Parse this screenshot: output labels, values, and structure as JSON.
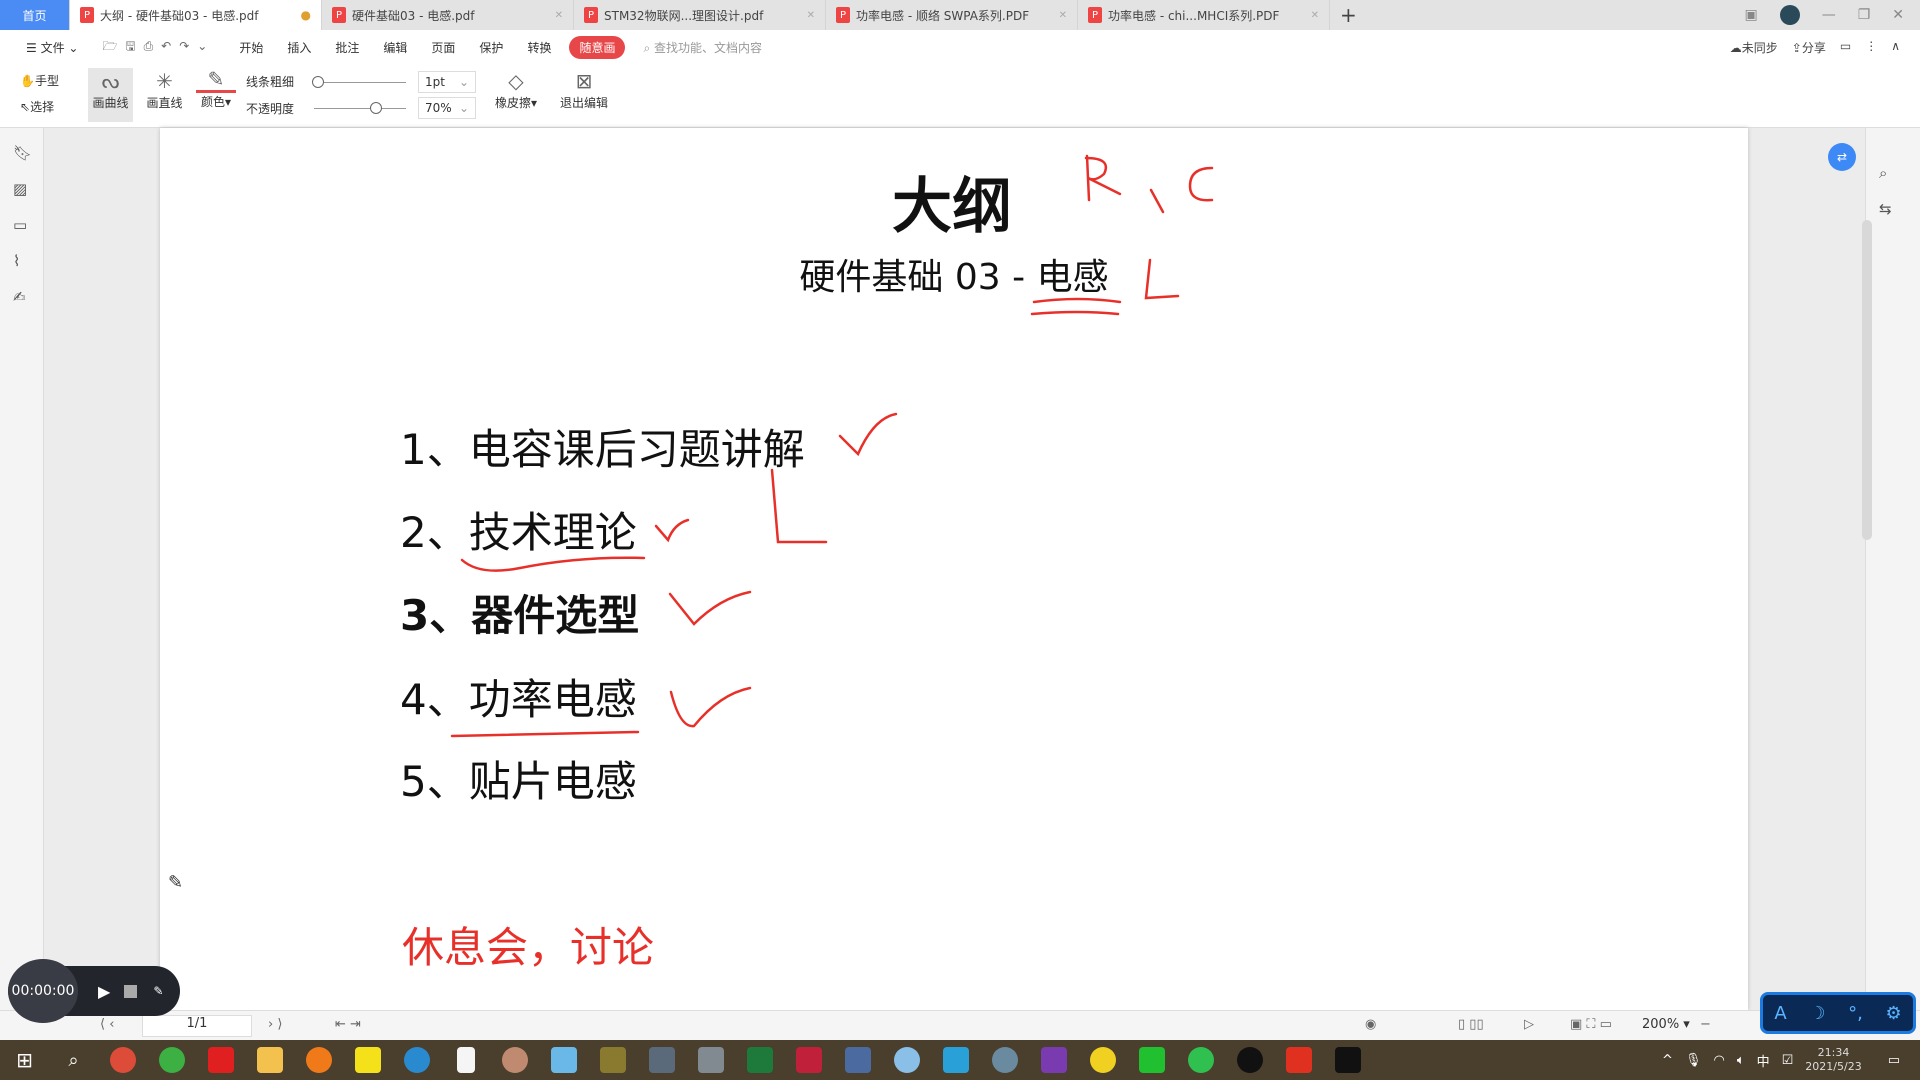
{
  "tabs": [
    {
      "label": "首页",
      "type": "home"
    },
    {
      "label": "大纲 - 硬件基础03 - 电感.pdf",
      "active": true,
      "modified": true
    },
    {
      "label": "硬件基础03 - 电感.pdf"
    },
    {
      "label": "STM32物联网...理图设计.pdf"
    },
    {
      "label": "功率电感 - 顺络 SWPA系列.PDF"
    },
    {
      "label": "功率电感 - chi...MHCI系列.PDF"
    }
  ],
  "new_tab": "+",
  "menu": {
    "file": "文件",
    "items": [
      "开始",
      "插入",
      "批注",
      "编辑",
      "页面",
      "保护",
      "转换"
    ],
    "active": "随意画",
    "search_placeholder": "查找功能、文档内容",
    "sync": "未同步",
    "share": "分享"
  },
  "toolbar": {
    "hand": "手型",
    "select": "选择",
    "curve": "画曲线",
    "line": "画直线",
    "color": "颜色",
    "thickness_label": "线条粗细",
    "thickness": "1pt",
    "opacity_label": "不透明度",
    "opacity": "70%",
    "eraser": "橡皮擦",
    "exit": "退出编辑",
    "accent": "#e8474a"
  },
  "document": {
    "title": "大纲",
    "subtitle_prefix": "硬件基础 03 - ",
    "subtitle_word": "电感",
    "items": [
      "1、电容课后习题讲解",
      "2、技术理论",
      "3、器件选型",
      "4、功率电感",
      "5、贴片电感"
    ],
    "bold_item": 2,
    "footer": "休息会，讨论",
    "footer_color": "#e8302a",
    "ink_color": "#e8302a"
  },
  "status": {
    "page": "1/1",
    "zoom": "200%"
  },
  "recorder": {
    "time": "00:00:00"
  },
  "clock": {
    "time": "21:34",
    "date": "2021/5/23"
  },
  "tray": {
    "ime": "中"
  }
}
